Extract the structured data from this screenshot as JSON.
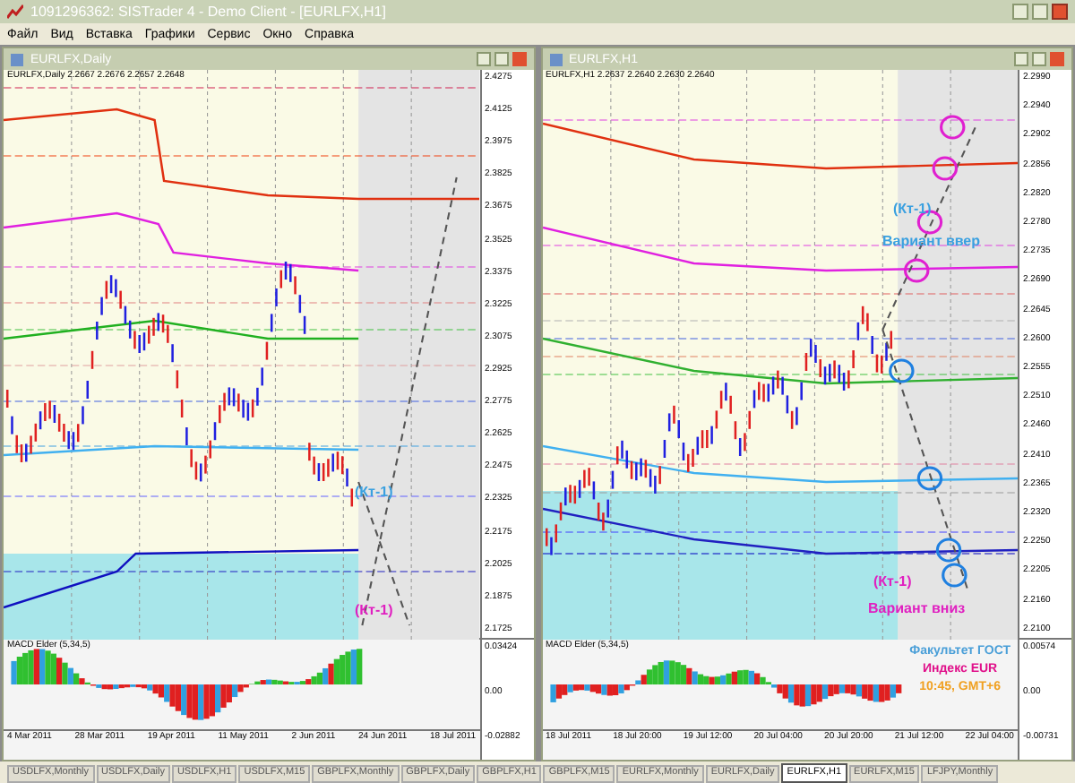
{
  "window": {
    "title": "1091296362: SISTrader 4 - Demo Client - [EURLFX,H1]"
  },
  "menu": [
    "Файл",
    "Вид",
    "Вставка",
    "Графики",
    "Сервис",
    "Окно",
    "Справка"
  ],
  "charts": [
    {
      "title": "EURLFX,Daily",
      "header": "EURLFX,Daily 2.2667 2.2676 2.2657 2.2648",
      "price_axis": [
        "2.4275",
        "2.4125",
        "2.3975",
        "2.3825",
        "2.3675",
        "2.3525",
        "2.3375",
        "2.3225",
        "2.3075",
        "2.2925",
        "2.2775",
        "2.2625",
        "2.2475",
        "2.2325",
        "2.2175",
        "2.2025",
        "2.1875",
        "2.1725"
      ],
      "annotations": [
        {
          "text": "(Кт-1)",
          "kind": "blue"
        },
        {
          "text": "(Кт-1)",
          "kind": "magenta"
        }
      ],
      "macd": {
        "label": "MACD Elder (5,34,5)",
        "axis": [
          "0.03424",
          "0.00",
          "-0.02882"
        ]
      },
      "dates": [
        "4 Mar 2011",
        "28 Mar 2011",
        "19 Apr 2011",
        "11 May 2011",
        "2 Jun 2011",
        "24 Jun 2011",
        "18 Jul 2011"
      ]
    },
    {
      "title": "EURLFX,H1",
      "header": "EURLFX,H1 2.2637 2.2640 2.2630 2.2640",
      "price_axis": [
        "2.2990",
        "2.2940",
        "2.2902",
        "2.2856",
        "2.2820",
        "2.2780",
        "2.2735",
        "2.2690",
        "2.2645",
        "2.2600",
        "2.2555",
        "2.2510",
        "2.2460",
        "2.2410",
        "2.2365",
        "2.2320",
        "2.2250",
        "2.2205",
        "2.2160",
        "2.2100"
      ],
      "annotations": [
        {
          "text": "(Кт-1)",
          "kind": "blue"
        },
        {
          "text": "Вариант ввер",
          "kind": "blue"
        },
        {
          "text": "(Кт-1)",
          "kind": "magenta"
        },
        {
          "text": "Вариант вниз",
          "kind": "magenta"
        }
      ],
      "macd": {
        "label": "MACD Elder (5,34,5)",
        "axis": [
          "0.00574",
          "0.00",
          "-0.00731"
        ]
      },
      "dates": [
        "18 Jul 2011",
        "18 Jul 20:00",
        "19 Jul 12:00",
        "20 Jul 04:00",
        "20 Jul 20:00",
        "21 Jul 12:00",
        "22 Jul 04:00"
      ]
    }
  ],
  "overlay": [
    {
      "text": "Факультет ГОСТ",
      "color": "#4a9fd8"
    },
    {
      "text": "Индекс EUR",
      "color": "#e0108a"
    },
    {
      "text": "10:45, GMT+6",
      "color": "#f0a020"
    }
  ],
  "tabs": [
    {
      "label": "USDLFX,Monthly",
      "selected": false
    },
    {
      "label": "USDLFX,Daily",
      "selected": false
    },
    {
      "label": "USDLFX,H1",
      "selected": false
    },
    {
      "label": "USDLFX,M15",
      "selected": false
    },
    {
      "label": "GBPLFX,Monthly",
      "selected": false
    },
    {
      "label": "GBPLFX,Daily",
      "selected": false
    },
    {
      "label": "GBPLFX,H1",
      "selected": false
    },
    {
      "label": "GBPLFX,M15",
      "selected": false
    },
    {
      "label": "EURLFX,Monthly",
      "selected": false
    },
    {
      "label": "EURLFX,Daily",
      "selected": false
    },
    {
      "label": "EURLFX,H1",
      "selected": true
    },
    {
      "label": "EURLFX,M15",
      "selected": false
    },
    {
      "label": "LFJPY,Monthly",
      "selected": false
    }
  ]
}
